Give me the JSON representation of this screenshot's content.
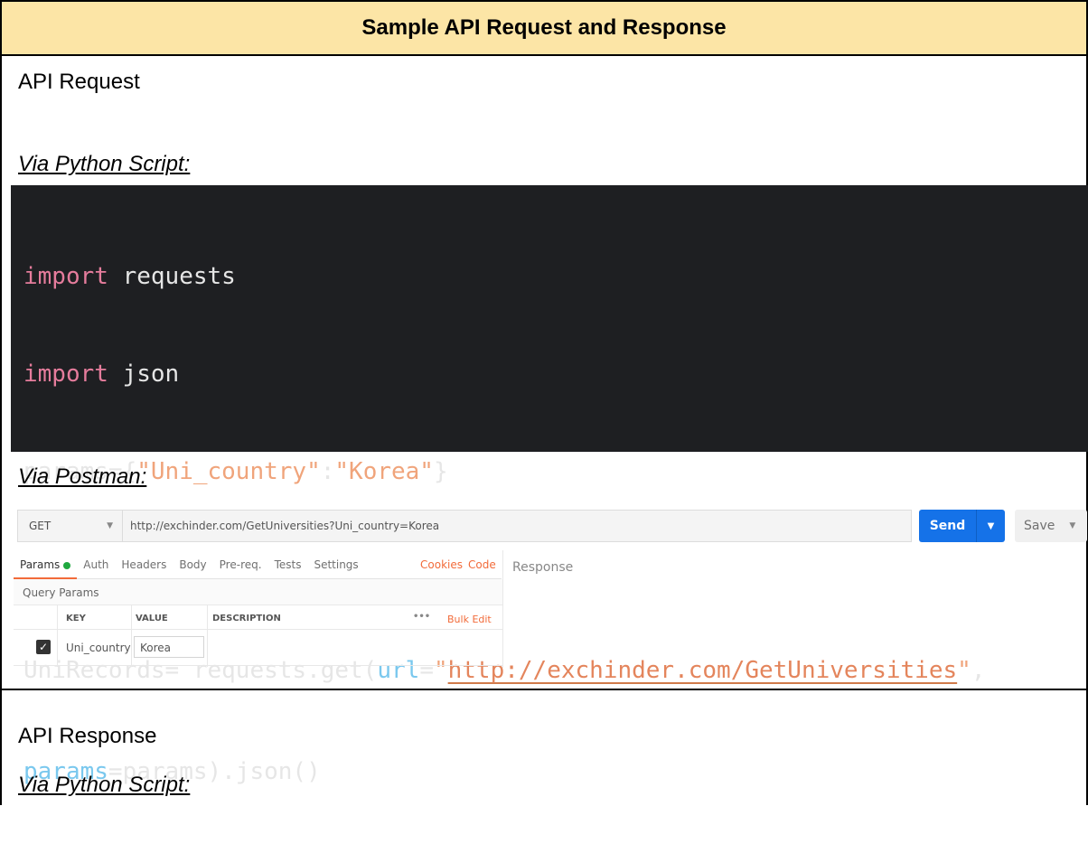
{
  "header": {
    "title": "Sample API Request and Response"
  },
  "request": {
    "label": "API Request",
    "via_python": "Via Python Script:",
    "via_postman": "Via Postman:",
    "code": {
      "line1_kw": "import",
      "line1_rest": " requests",
      "line2_kw": "import",
      "line2_rest": " json",
      "line3_a": "params={",
      "line3_key": "\"Uni_country\"",
      "line3_colon": ":",
      "line3_val": "\"Korea\"",
      "line3_end": "}",
      "line5_a": "UniRecords= requests.get(",
      "line5_param": "url",
      "line5_eq": "=",
      "line5_quote_open": "\"",
      "line5_url": "http://exchinder.com/GetUniversities",
      "line5_quote_close": "\"",
      "line5_end": ",",
      "line6_param": "params",
      "line6_rest": "=params).json()"
    }
  },
  "postman": {
    "method": "GET",
    "url": "http://exchinder.com/GetUniversities?Uni_country=Korea",
    "send_label": "Send",
    "save_label": "Save",
    "tabs": [
      "Params",
      "Auth",
      "Headers",
      "Body",
      "Pre-req.",
      "Tests",
      "Settings"
    ],
    "cookies_label": "Cookies",
    "code_label": "Code",
    "response_label": "Response",
    "query_params_title": "Query Params",
    "columns": {
      "key": "KEY",
      "value": "VALUE",
      "description": "DESCRIPTION"
    },
    "more_label": "•••",
    "bulk_edit_label": "Bulk Edit",
    "row": {
      "key": "Uni_country",
      "value": "Korea",
      "checked": true
    },
    "colors": {
      "send": "#1572e8",
      "accent": "#f26b3a",
      "active_dot": "#1fa83f"
    }
  },
  "response": {
    "label": "API Response",
    "via_python": "Via Python Script:"
  }
}
